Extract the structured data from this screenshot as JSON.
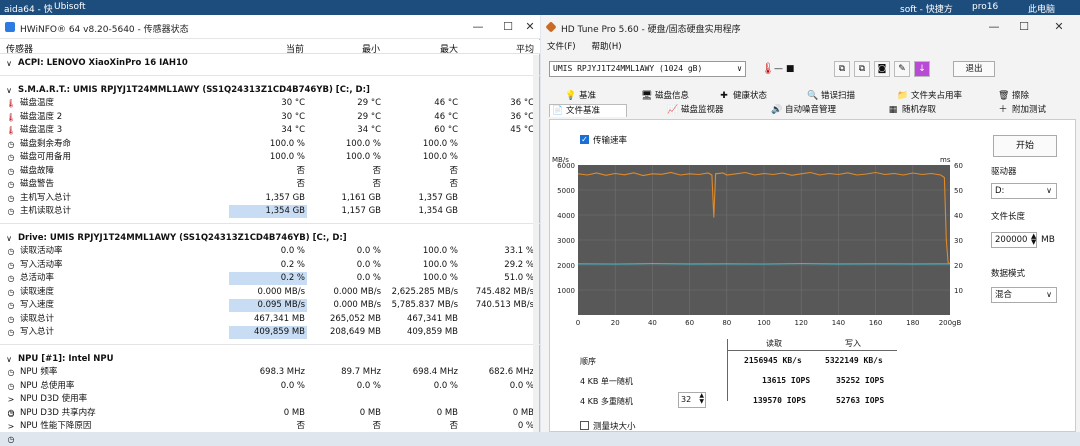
{
  "taskbar": {
    "left1": "aida64 - 快",
    "left2": "Ubisoft",
    "right1": "soft - 快捷方",
    "right2": "pro16",
    "right3": "此电脑"
  },
  "hwinfo": {
    "title": "HWiNFO® 64 v8.20-5640 - 传感器状态",
    "columns": {
      "sensor": "传感器",
      "current": "当前",
      "min": "最小",
      "max": "最大",
      "avg": "平均"
    },
    "rows": [
      {
        "type": "sec",
        "icon": "∨",
        "label": "ACPI: LENOVO XiaoXinPro 16 IAH10",
        "cur": "",
        "min": "",
        "max": "",
        "avg": ""
      },
      {
        "type": "div"
      },
      {
        "type": "sec",
        "icon": "∨",
        "label": "S.M.A.R.T.: UMIS RPJYJ1T24MML1AWY (SS1Q24313Z1CD4B746YB) [C:, D:]",
        "cur": "",
        "min": "",
        "max": "",
        "avg": ""
      },
      {
        "type": "item",
        "icon": "🌡",
        "label": "磁盘温度",
        "cur": "30 °C",
        "min": "29 °C",
        "max": "46 °C",
        "avg": "36 °C"
      },
      {
        "type": "item",
        "icon": "🌡",
        "label": "磁盘温度 2",
        "cur": "30 °C",
        "min": "29 °C",
        "max": "46 °C",
        "avg": "36 °C"
      },
      {
        "type": "item",
        "icon": "🌡",
        "label": "磁盘温度 3",
        "cur": "34 °C",
        "min": "34 °C",
        "max": "60 °C",
        "avg": "45 °C"
      },
      {
        "type": "item",
        "icon": "◷",
        "label": "磁盘剩余寿命",
        "cur": "100.0 %",
        "min": "100.0 %",
        "max": "100.0 %",
        "avg": ""
      },
      {
        "type": "item",
        "icon": "◷",
        "label": "磁盘可用备用",
        "cur": "100.0 %",
        "min": "100.0 %",
        "max": "100.0 %",
        "avg": ""
      },
      {
        "type": "item",
        "icon": "◷",
        "label": "磁盘故障",
        "cur": "否",
        "min": "否",
        "max": "否",
        "avg": ""
      },
      {
        "type": "item",
        "icon": "◷",
        "label": "磁盘警告",
        "cur": "否",
        "min": "否",
        "max": "否",
        "avg": ""
      },
      {
        "type": "item",
        "icon": "◷",
        "label": "主机写入总计",
        "cur": "1,357 GB",
        "min": "1,161 GB",
        "max": "1,357 GB",
        "avg": ""
      },
      {
        "type": "item",
        "icon": "◷",
        "label": "主机读取总计",
        "cur": "1,354 GB",
        "min": "1,157 GB",
        "max": "1,354 GB",
        "avg": "",
        "hl": true
      },
      {
        "type": "div"
      },
      {
        "type": "sec",
        "icon": "∨",
        "label": "Drive: UMIS RPJYJ1T24MML1AWY (SS1Q24313Z1CD4B746YB) [C:, D:]",
        "cur": "",
        "min": "",
        "max": "",
        "avg": ""
      },
      {
        "type": "item",
        "icon": "◷",
        "label": "读取活动率",
        "cur": "0.0 %",
        "min": "0.0 %",
        "max": "100.0 %",
        "avg": "33.1 %"
      },
      {
        "type": "item",
        "icon": "◷",
        "label": "写入活动率",
        "cur": "0.2 %",
        "min": "0.0 %",
        "max": "100.0 %",
        "avg": "29.2 %"
      },
      {
        "type": "item",
        "icon": "◷",
        "label": "总活动率",
        "cur": "0.2 %",
        "min": "0.0 %",
        "max": "100.0 %",
        "avg": "51.0 %",
        "hl": true
      },
      {
        "type": "item",
        "icon": "◷",
        "label": "读取速度",
        "cur": "0.000 MB/s",
        "min": "0.000 MB/s",
        "max": "2,625.285 MB/s",
        "avg": "745.482 MB/s"
      },
      {
        "type": "item",
        "icon": "◷",
        "label": "写入速度",
        "cur": "0.095 MB/s",
        "min": "0.000 MB/s",
        "max": "5,785.837 MB/s",
        "avg": "740.513 MB/s",
        "hl": true
      },
      {
        "type": "item",
        "icon": "◷",
        "label": "读取总计",
        "cur": "467,341 MB",
        "min": "265,052 MB",
        "max": "467,341 MB",
        "avg": ""
      },
      {
        "type": "item",
        "icon": "◷",
        "label": "写入总计",
        "cur": "409,859 MB",
        "min": "208,649 MB",
        "max": "409,859 MB",
        "avg": "",
        "hl": true
      },
      {
        "type": "div"
      },
      {
        "type": "sec",
        "icon": "∨",
        "label": "NPU [#1]: Intel NPU",
        "cur": "",
        "min": "",
        "max": "",
        "avg": ""
      },
      {
        "type": "item",
        "icon": "◷",
        "label": "NPU 频率",
        "cur": "698.3 MHz",
        "min": "89.7 MHz",
        "max": "698.4 MHz",
        "avg": "682.6 MHz"
      },
      {
        "type": "item",
        "icon": "◷",
        "label": "NPU 总使用率",
        "cur": "0.0 %",
        "min": "0.0 %",
        "max": "0.0 %",
        "avg": "0.0 %"
      },
      {
        "type": "item",
        "icon": "> ◷",
        "label": "NPU D3D 使用率",
        "cur": "",
        "min": "",
        "max": "",
        "avg": ""
      },
      {
        "type": "item",
        "icon": "◷",
        "label": "NPU D3D 共享内存",
        "cur": "0 MB",
        "min": "0 MB",
        "max": "0 MB",
        "avg": "0 MB"
      },
      {
        "type": "item",
        "icon": "> ◷",
        "label": "NPU 性能下降原因",
        "cur": "否",
        "min": "否",
        "max": "否",
        "avg": "0 %"
      }
    ]
  },
  "hdtune": {
    "title": "HD Tune Pro 5.60 - 硬盘/固态硬盘实用程序",
    "menu": {
      "file": "文件(F)",
      "help": "帮助(H)"
    },
    "drive": "UMIS RPJYJ1T24MML1AWY (1024 gB)",
    "temp": "— ■",
    "exit": "退出",
    "tabs_row1": [
      {
        "icon": "💡",
        "label": "基准"
      },
      {
        "icon": "🖥",
        "label": "磁盘信息"
      },
      {
        "icon": "✚",
        "label": "健康状态"
      },
      {
        "icon": "🔍",
        "label": "错误扫描"
      },
      {
        "icon": "📁",
        "label": "文件夹占用率"
      },
      {
        "icon": "🗑",
        "label": "擦除"
      }
    ],
    "tabs_row2": [
      {
        "icon": "📄",
        "label": "文件基准"
      },
      {
        "icon": "📈",
        "label": "磁盘监视器"
      },
      {
        "icon": "🔊",
        "label": "自动噪音管理"
      },
      {
        "icon": "▦",
        "label": "随机存取"
      },
      {
        "icon": "＋",
        "label": "附加测试"
      }
    ],
    "transfer_rate_label": "传输速率",
    "start": "开始",
    "drive_label": "驱动器",
    "drive_value": "D:",
    "file_length_label": "文件长度",
    "file_length_value": "200000",
    "file_length_unit": "MB",
    "data_mode_label": "数据模式",
    "data_mode_value": "混合",
    "results": {
      "hdr_read": "读取",
      "hdr_write": "写入",
      "rows": [
        {
          "label": "顺序",
          "read": "2156945 KB/s",
          "write": "5322149 KB/s"
        },
        {
          "label": "4 KB 单一随机",
          "read": "13615 IOPS",
          "write": "35252 IOPS"
        },
        {
          "label": "4 KB 多重随机",
          "read": "139570 IOPS",
          "write": "52763 IOPS"
        }
      ],
      "queue_depth": "32"
    },
    "measure_label": "测量块大小"
  },
  "chart_data": {
    "type": "line",
    "y_left_unit": "MB/s",
    "y_right_unit": "ms",
    "y_left_ticks": [
      "6000",
      "5000",
      "4000",
      "3000",
      "2000",
      "1000"
    ],
    "y_right_ticks": [
      "60",
      "50",
      "40",
      "30",
      "20",
      "10"
    ],
    "x_ticks": [
      "0",
      "20",
      "40",
      "60",
      "80",
      "100",
      "120",
      "140",
      "160",
      "180",
      "200gB"
    ],
    "xlim": [
      0,
      200
    ],
    "ylim": [
      0,
      6000
    ],
    "colors": {
      "write": "#e08a2a",
      "read": "#3cb6c8",
      "grid": "#707070",
      "bg": "#585858"
    },
    "series": [
      {
        "key": "write",
        "points": [
          [
            0,
            5650
          ],
          [
            5,
            5600
          ],
          [
            10,
            5680
          ],
          [
            15,
            5590
          ],
          [
            20,
            5660
          ],
          [
            25,
            5610
          ],
          [
            30,
            5690
          ],
          [
            35,
            5580
          ],
          [
            40,
            5650
          ],
          [
            45,
            5630
          ],
          [
            50,
            5700
          ],
          [
            55,
            5600
          ],
          [
            60,
            5650
          ],
          [
            65,
            5620
          ],
          [
            70,
            5680
          ],
          [
            72,
            5600
          ],
          [
            73,
            3900
          ],
          [
            74,
            5650
          ],
          [
            78,
            5680
          ],
          [
            80,
            5600
          ],
          [
            85,
            5650
          ],
          [
            90,
            5700
          ],
          [
            95,
            5600
          ],
          [
            100,
            5660
          ],
          [
            105,
            5620
          ],
          [
            110,
            5680
          ],
          [
            115,
            5590
          ],
          [
            120,
            5650
          ],
          [
            125,
            5700
          ],
          [
            130,
            5600
          ],
          [
            135,
            5660
          ],
          [
            140,
            5620
          ],
          [
            145,
            5690
          ],
          [
            150,
            5600
          ],
          [
            155,
            5640
          ],
          [
            160,
            5700
          ],
          [
            165,
            5620
          ],
          [
            170,
            5660
          ],
          [
            175,
            5600
          ],
          [
            180,
            5680
          ],
          [
            185,
            5620
          ],
          [
            190,
            5660
          ],
          [
            195,
            5600
          ],
          [
            197,
            5500
          ],
          [
            198,
            3000
          ],
          [
            199,
            2100
          ],
          [
            200,
            2050
          ]
        ]
      },
      {
        "key": "read",
        "points": [
          [
            0,
            2050
          ],
          [
            20,
            2040
          ],
          [
            40,
            2055
          ],
          [
            60,
            2045
          ],
          [
            80,
            2050
          ],
          [
            100,
            2040
          ],
          [
            120,
            2055
          ],
          [
            140,
            2045
          ],
          [
            160,
            2050
          ],
          [
            180,
            2045
          ],
          [
            200,
            2050
          ]
        ]
      }
    ]
  }
}
